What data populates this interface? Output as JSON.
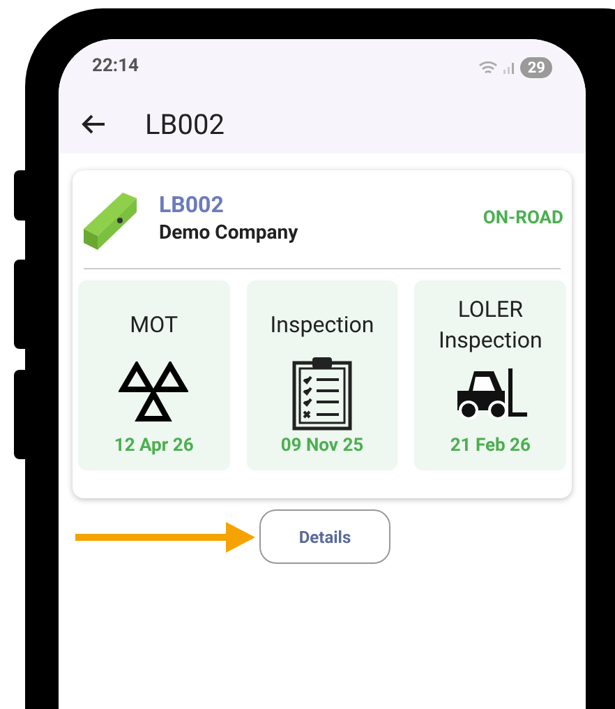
{
  "status_bar": {
    "time": "22:14",
    "battery": "29"
  },
  "app_bar": {
    "title": "LB002"
  },
  "vehicle": {
    "id": "LB002",
    "company": "Demo Company",
    "status": "ON-ROAD"
  },
  "checks": [
    {
      "kind": "mot",
      "title": "MOT",
      "date": "12 Apr 26"
    },
    {
      "kind": "inspection",
      "title": "Inspection",
      "date": "09 Nov 25"
    },
    {
      "kind": "loler",
      "title": "LOLER Inspection",
      "date": "21 Feb 26"
    }
  ],
  "details_button": {
    "label": "Details"
  }
}
